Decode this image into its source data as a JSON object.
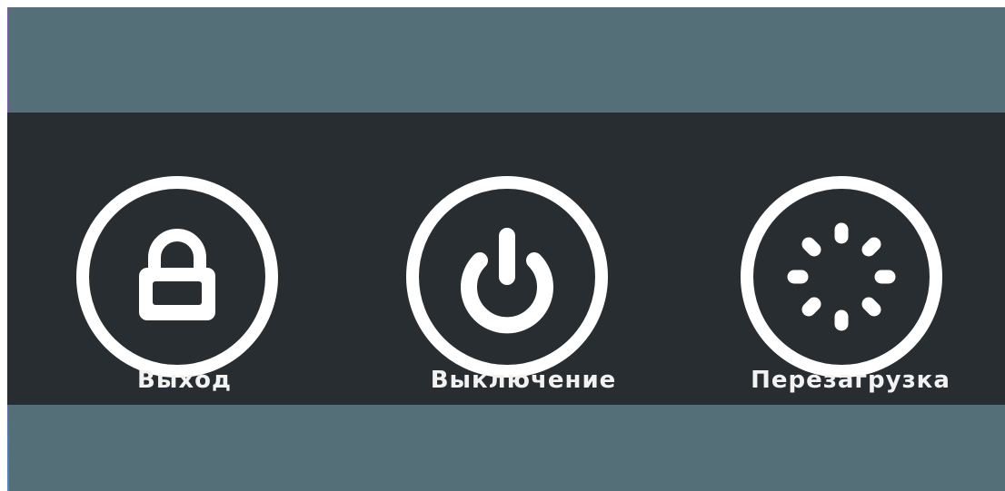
{
  "colors": {
    "background": "#546f78",
    "panel": "#272d30",
    "foreground": "#ffffff"
  },
  "power_menu": {
    "options": [
      {
        "label": "Выход",
        "icon": "lock-icon"
      },
      {
        "label": "Выключение",
        "icon": "power-icon"
      },
      {
        "label": "Перезагрузка",
        "icon": "restart-spinner-icon"
      }
    ]
  }
}
